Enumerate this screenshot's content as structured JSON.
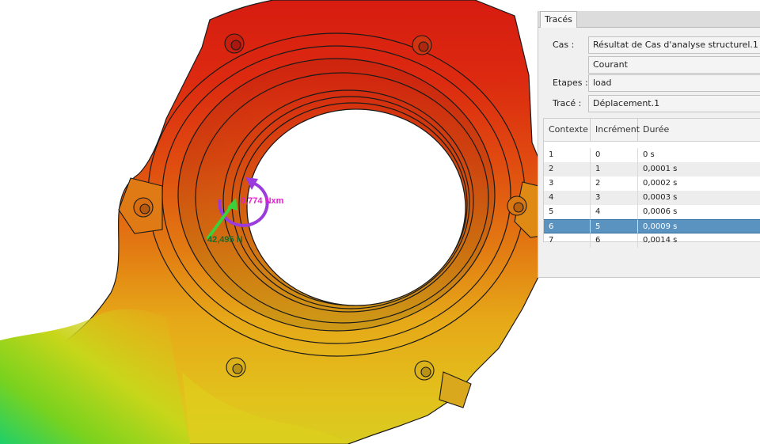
{
  "panel": {
    "tab_label": "Tracés",
    "fields": [
      {
        "label": "Cas :",
        "value": "Résultat de Cas d'analyse structurel.1"
      },
      {
        "label": "",
        "value": "Courant"
      },
      {
        "label": "Etapes :",
        "value": "load"
      },
      {
        "label": "Tracé :",
        "value": "Déplacement.1"
      }
    ],
    "table": {
      "columns": [
        "Contexte",
        "Incrément",
        "Durée"
      ],
      "rows": [
        [
          "1",
          "0",
          "0 s"
        ],
        [
          "2",
          "1",
          "0,0001 s"
        ],
        [
          "3",
          "2",
          "0,0002 s"
        ],
        [
          "4",
          "3",
          "0,0003 s"
        ],
        [
          "5",
          "4",
          "0,0006 s"
        ],
        [
          "6",
          "5",
          "0,0009 s"
        ],
        [
          "7",
          "6",
          "0,0014 s"
        ]
      ],
      "selected_row": 5
    }
  },
  "viewport": {
    "moment_label": "0,774 Nxm",
    "force_label": "42,495 N",
    "colors": {
      "moment": "#9b3bdc",
      "moment_text": "#e51fd0",
      "force": "#3ad13a",
      "force_text": "#1f6b2a"
    }
  }
}
